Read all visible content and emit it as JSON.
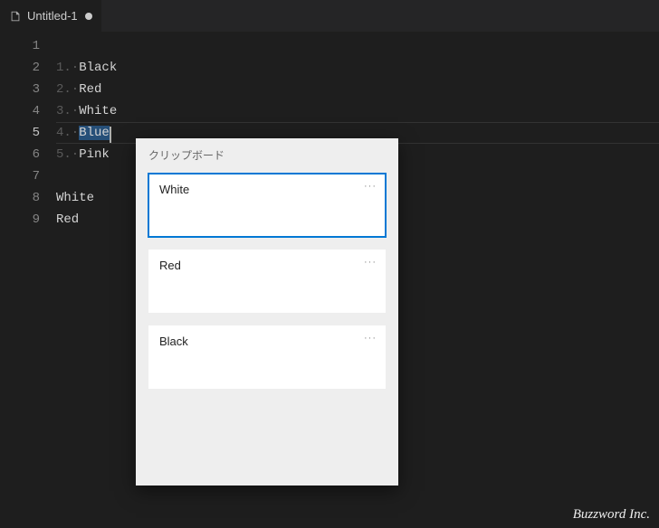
{
  "tab": {
    "title": "Untitled-1",
    "modified": true
  },
  "editor": {
    "currentLine": 5,
    "lineNumbers": [
      "1",
      "2",
      "3",
      "4",
      "5",
      "6",
      "7",
      "8",
      "9"
    ],
    "lines": [
      {
        "indent": "",
        "text": ""
      },
      {
        "indent": "1.·",
        "text": "Black"
      },
      {
        "indent": "2.·",
        "text": "Red"
      },
      {
        "indent": "3.·",
        "text": "White"
      },
      {
        "indent": "4.·",
        "text": "Blue",
        "selected": true,
        "cursorAfter": true
      },
      {
        "indent": "5.·",
        "text": "Pink"
      },
      {
        "indent": "",
        "text": ""
      },
      {
        "indent": "",
        "text": "White"
      },
      {
        "indent": "",
        "text": "Red"
      }
    ]
  },
  "clipboard": {
    "title": "クリップボード",
    "items": [
      {
        "text": "White",
        "selected": true
      },
      {
        "text": "Red",
        "selected": false
      },
      {
        "text": "Black",
        "selected": false
      }
    ],
    "moreGlyph": "···"
  },
  "watermark": "Buzzword Inc."
}
